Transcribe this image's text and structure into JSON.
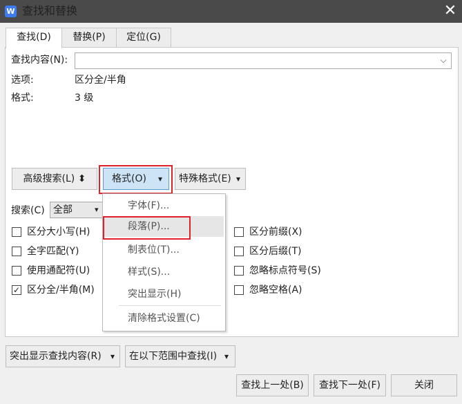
{
  "window": {
    "title": "查找和替换",
    "app_icon_letter": "W",
    "close_glyph": "✕"
  },
  "tabs": [
    {
      "label": "查找(D)",
      "active": true
    },
    {
      "label": "替换(P)",
      "active": false
    },
    {
      "label": "定位(G)",
      "active": false
    }
  ],
  "find": {
    "label": "查找内容(N):",
    "value": ""
  },
  "options": {
    "label": "选项:",
    "value": "区分全/半角"
  },
  "format": {
    "label": "格式:",
    "value": "3 级"
  },
  "buttons": {
    "advanced": "高级搜索(L) ⬍",
    "format": "格式(O)",
    "special": "特殊格式(E)",
    "highlight": "突出显示查找内容(R)",
    "find_in": "在以下范围中查找(I)",
    "find_prev": "查找上一处(B)",
    "find_next": "查找下一处(F)",
    "close": "关闭",
    "dropdown_arrow": "▾"
  },
  "search": {
    "label": "搜索(C)",
    "value": "全部"
  },
  "checkboxes_left": [
    {
      "label": "区分大小写(H)",
      "checked": false
    },
    {
      "label": "全字匹配(Y)",
      "checked": false
    },
    {
      "label": "使用通配符(U)",
      "checked": false
    },
    {
      "label": "区分全/半角(M)",
      "checked": true
    }
  ],
  "checkboxes_right": [
    {
      "label": "区分前缀(X)",
      "checked": false
    },
    {
      "label": "区分后缀(T)",
      "checked": false
    },
    {
      "label": "忽略标点符号(S)",
      "checked": false
    },
    {
      "label": "忽略空格(A)",
      "checked": false
    }
  ],
  "format_menu": [
    {
      "label": "字体(F)...",
      "highlighted": false
    },
    {
      "label": "段落(P)...",
      "highlighted": true
    },
    {
      "label": "制表位(T)...",
      "highlighted": false
    },
    {
      "label": "样式(S)...",
      "highlighted": false
    },
    {
      "label": "突出显示(H)",
      "highlighted": false
    },
    {
      "label": "清除格式设置(C)",
      "highlighted": false
    }
  ],
  "colors": {
    "title_bar": "#4a4a4a",
    "highlight_frame": "#e0202a",
    "selected_button": "#cde4f7"
  }
}
